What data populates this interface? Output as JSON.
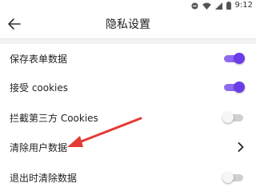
{
  "status_bar": {
    "time": "9:12",
    "icons": [
      "minus-circle-icon",
      "wifi-icon",
      "signal-icon",
      "battery-icon"
    ]
  },
  "header": {
    "title": "隐私设置",
    "back_icon": "arrow-left-icon"
  },
  "settings": [
    {
      "label": "保存表单数据",
      "control": "toggle",
      "state": "on"
    },
    {
      "label": "接受 cookies",
      "control": "toggle",
      "state": "on"
    },
    {
      "label": "拦截第三方 Cookies",
      "control": "toggle",
      "state": "off"
    },
    {
      "label": "清除用户数据",
      "control": "chevron-right-icon"
    },
    {
      "label": "退出时清除数据",
      "control": "toggle",
      "state": "off"
    }
  ],
  "colors": {
    "toggle_on_thumb": "#6a3de8",
    "toggle_on_track": "#8f6af0",
    "annotation_arrow": "#e53935"
  },
  "annotation": {
    "type": "red-arrow",
    "points_to": "清除用户数据"
  }
}
